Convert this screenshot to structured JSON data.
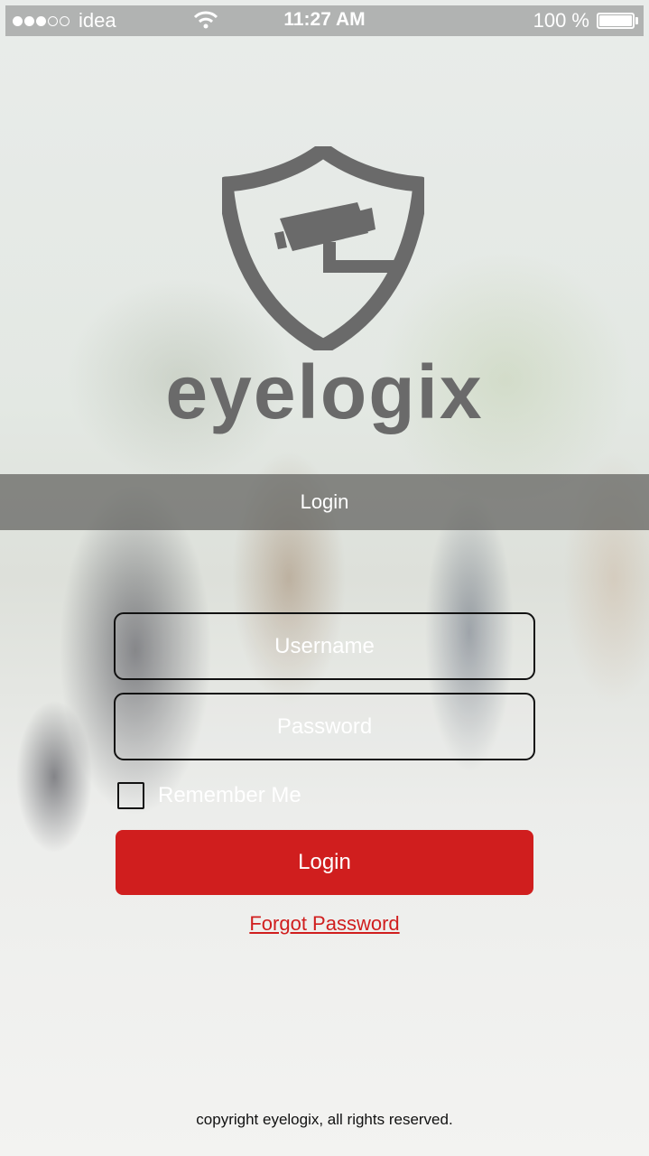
{
  "status_bar": {
    "signal_bars_filled": 3,
    "signal_bars_total": 5,
    "carrier": "idea",
    "time": "11:27 AM",
    "battery_label": "100 %",
    "battery_level": 1.0
  },
  "brand": {
    "name": "eyelogix",
    "logo_icon": "shield-camera-icon",
    "color": "#6a6a6a"
  },
  "header": {
    "title": "Login"
  },
  "form": {
    "username_placeholder": "Username",
    "username_value": "",
    "password_placeholder": "Password",
    "password_value": "",
    "remember_label": "Remember Me",
    "remember_checked": false,
    "submit_label": "Login",
    "forgot_label": "Forgot Password"
  },
  "footer": {
    "copyright": "copyright eyelogix, all rights reserved."
  },
  "colors": {
    "accent": "#d01e1e",
    "status_bar_bg": "#b1b3b2"
  }
}
